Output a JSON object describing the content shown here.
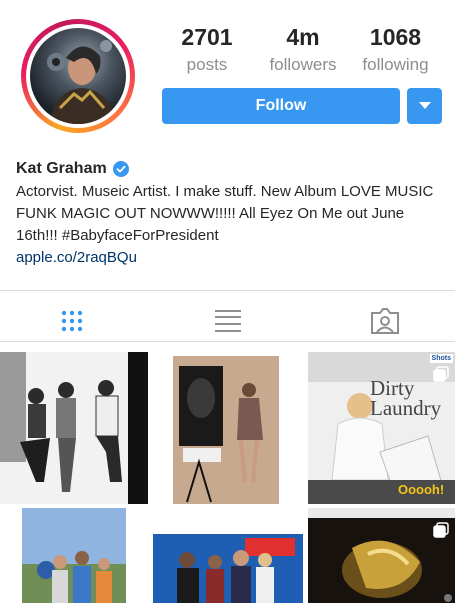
{
  "profile": {
    "name": "Kat Graham",
    "bio": "Actorvist. Museic Artist. I make stuff. New Album LOVE MUSIC FUNK MAGIC OUT NOWWW!!!!! All Eyez On Me out June 16th!!! #BabyfaceForPresident",
    "link": "apple.co/2raqBQu"
  },
  "stats": [
    {
      "value": "2701",
      "label": "posts"
    },
    {
      "value": "4m",
      "label": "followers"
    },
    {
      "value": "1068",
      "label": "following"
    }
  ],
  "actions": {
    "follow_label": "Follow"
  },
  "tabs": [
    {
      "name": "grid",
      "icon": "grid-icon",
      "active": true
    },
    {
      "name": "list",
      "icon": "list-icon",
      "active": false
    },
    {
      "name": "tagged",
      "icon": "tagged-person-icon",
      "active": false
    }
  ],
  "posts": {
    "tile3_title": "Dirty Laundry",
    "tile3_caption": "Ooooh!",
    "tile3_badge": "Shots"
  },
  "colors": {
    "accent": "#3897f0",
    "link": "#003569",
    "muted": "#8e8e8e"
  }
}
